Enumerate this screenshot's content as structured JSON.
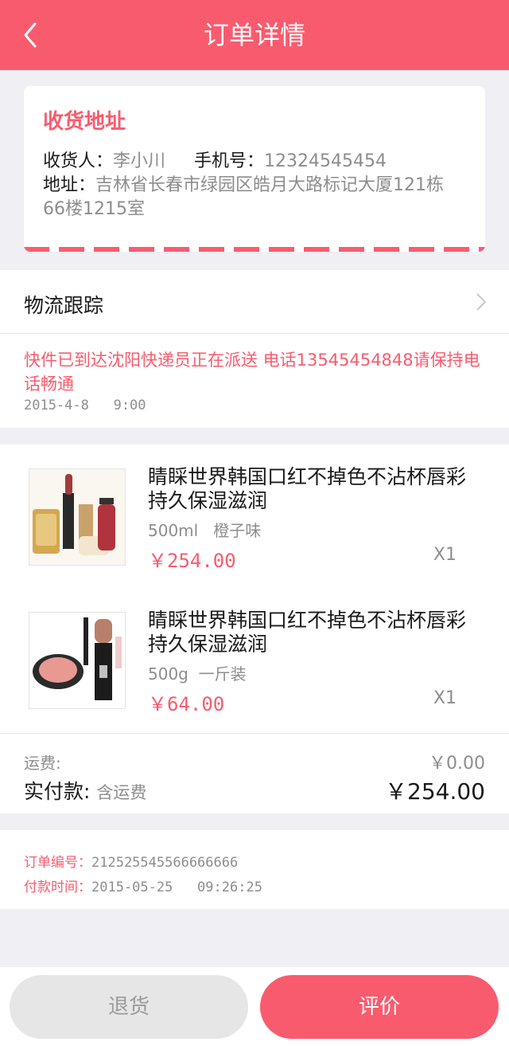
{
  "header": {
    "title": "订单详情"
  },
  "address": {
    "section_title": "收货地址",
    "receiver_label": "收货人：",
    "receiver_name": "李小川",
    "phone_label": "手机号：",
    "phone": "12324545454",
    "address_label": "地址：",
    "address": "吉林省长春市绿园区皓月大路标记大厦121栋66楼1215室"
  },
  "logistics": {
    "title": "物流跟踪",
    "message": "快件已到达沈阳快递员正在派送 电话13545454848请保持电话畅通",
    "time": "2015-4-8   9:00"
  },
  "goods": [
    {
      "name": "睛睬世界韩国口红不掉色不沾杯唇彩持久保湿滋润",
      "spec": "500ml   橙子味",
      "price": "￥254.00",
      "qty": "X1"
    },
    {
      "name": "睛睬世界韩国口红不掉色不沾杯唇彩持久保湿滋润",
      "spec": "500g  一斤装",
      "price": "￥64.00",
      "qty": "X1"
    }
  ],
  "summary": {
    "shipping_label": "运费:",
    "shipping_value": "￥0.00",
    "paid_label": "实付款:",
    "paid_note": "含运费",
    "paid_value": "￥254.00"
  },
  "order": {
    "number_label": "订单编号：",
    "number": "212525545566666666",
    "pay_time_label": "付款时间：",
    "pay_time": "2015-05-25   09:26:25"
  },
  "actions": {
    "return_label": "退货",
    "review_label": "评价"
  },
  "colors": {
    "accent": "#f95b6e",
    "background": "#efeff4"
  }
}
